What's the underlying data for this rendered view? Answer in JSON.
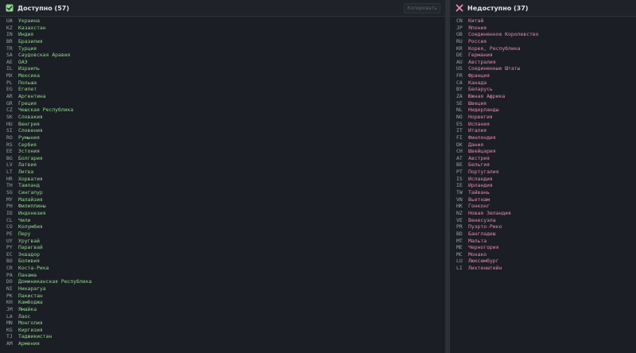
{
  "available": {
    "title": "Доступно (57)",
    "copy_label": "Копировать",
    "icon": "check-square-icon",
    "accent": "#8fd48b",
    "items": [
      {
        "code": "UA",
        "name": "Украина"
      },
      {
        "code": "KZ",
        "name": "Казахстан"
      },
      {
        "code": "IN",
        "name": "Индия"
      },
      {
        "code": "BR",
        "name": "Бразилия"
      },
      {
        "code": "TR",
        "name": "Турция"
      },
      {
        "code": "SA",
        "name": "Саудовская Аравия"
      },
      {
        "code": "AE",
        "name": "ОАЭ"
      },
      {
        "code": "IL",
        "name": "Израиль"
      },
      {
        "code": "MX",
        "name": "Мексика"
      },
      {
        "code": "PL",
        "name": "Польша"
      },
      {
        "code": "EG",
        "name": "Египет"
      },
      {
        "code": "AR",
        "name": "Аргентина"
      },
      {
        "code": "GR",
        "name": "Греция"
      },
      {
        "code": "CZ",
        "name": "Чешская Республика"
      },
      {
        "code": "SK",
        "name": "Словакия"
      },
      {
        "code": "HU",
        "name": "Венгрия"
      },
      {
        "code": "SI",
        "name": "Словения"
      },
      {
        "code": "RO",
        "name": "Румыния"
      },
      {
        "code": "RS",
        "name": "Сербия"
      },
      {
        "code": "EE",
        "name": "Эстония"
      },
      {
        "code": "BG",
        "name": "Болгария"
      },
      {
        "code": "LV",
        "name": "Латвия"
      },
      {
        "code": "LT",
        "name": "Литва"
      },
      {
        "code": "HR",
        "name": "Хорватия"
      },
      {
        "code": "TH",
        "name": "Таиланд"
      },
      {
        "code": "SG",
        "name": "Сингапур"
      },
      {
        "code": "MY",
        "name": "Малайзия"
      },
      {
        "code": "PH",
        "name": "Филиппины"
      },
      {
        "code": "ID",
        "name": "Индонезия"
      },
      {
        "code": "CL",
        "name": "Чили"
      },
      {
        "code": "CO",
        "name": "Колумбия"
      },
      {
        "code": "PE",
        "name": "Перу"
      },
      {
        "code": "UY",
        "name": "Уругвай"
      },
      {
        "code": "PY",
        "name": "Парагвай"
      },
      {
        "code": "EC",
        "name": "Эквадор"
      },
      {
        "code": "BO",
        "name": "Боливия"
      },
      {
        "code": "CR",
        "name": "Коста-Рика"
      },
      {
        "code": "PA",
        "name": "Панама"
      },
      {
        "code": "DO",
        "name": "Доминиканская Республика"
      },
      {
        "code": "NI",
        "name": "Никарагуа"
      },
      {
        "code": "PK",
        "name": "Пакистан"
      },
      {
        "code": "KH",
        "name": "Камбоджа"
      },
      {
        "code": "JM",
        "name": "Ямайка"
      },
      {
        "code": "LA",
        "name": "Лаос"
      },
      {
        "code": "MN",
        "name": "Монголия"
      },
      {
        "code": "KG",
        "name": "Киргизия"
      },
      {
        "code": "TJ",
        "name": "Таджикистан"
      },
      {
        "code": "AM",
        "name": "Армения"
      }
    ]
  },
  "unavailable": {
    "title": "Недоступно (37)",
    "icon": "x-mark-icon",
    "accent": "#e38ab3",
    "items": [
      {
        "code": "CN",
        "name": "Китай"
      },
      {
        "code": "JP",
        "name": "Япония"
      },
      {
        "code": "GB",
        "name": "Соединенное Королевство"
      },
      {
        "code": "RU",
        "name": "Россия"
      },
      {
        "code": "KR",
        "name": "Корея, Республика"
      },
      {
        "code": "DE",
        "name": "Германия"
      },
      {
        "code": "AU",
        "name": "Австралия"
      },
      {
        "code": "US",
        "name": "Соединенные Штаты"
      },
      {
        "code": "FR",
        "name": "Франция"
      },
      {
        "code": "CA",
        "name": "Канада"
      },
      {
        "code": "BY",
        "name": "Беларусь"
      },
      {
        "code": "ZA",
        "name": "Южная Африка"
      },
      {
        "code": "SE",
        "name": "Швеция"
      },
      {
        "code": "NL",
        "name": "Нидерланды"
      },
      {
        "code": "NO",
        "name": "Норвегия"
      },
      {
        "code": "ES",
        "name": "Испания"
      },
      {
        "code": "IT",
        "name": "Италия"
      },
      {
        "code": "FI",
        "name": "Финляндия"
      },
      {
        "code": "DK",
        "name": "Дания"
      },
      {
        "code": "CH",
        "name": "Швейцария"
      },
      {
        "code": "AT",
        "name": "Австрия"
      },
      {
        "code": "BE",
        "name": "Бельгия"
      },
      {
        "code": "PT",
        "name": "Португалия"
      },
      {
        "code": "IS",
        "name": "Исландия"
      },
      {
        "code": "IE",
        "name": "Ирландия"
      },
      {
        "code": "TW",
        "name": "Тайвань"
      },
      {
        "code": "VN",
        "name": "Вьетнам"
      },
      {
        "code": "HK",
        "name": "Гонконг"
      },
      {
        "code": "NZ",
        "name": "Новая Зеландия"
      },
      {
        "code": "VE",
        "name": "Венесуэла"
      },
      {
        "code": "PR",
        "name": "Пуэрто-Рико"
      },
      {
        "code": "BD",
        "name": "Бангладеш"
      },
      {
        "code": "MT",
        "name": "Мальта"
      },
      {
        "code": "ME",
        "name": "Черногория"
      },
      {
        "code": "MC",
        "name": "Монако"
      },
      {
        "code": "LU",
        "name": "Люксембург"
      },
      {
        "code": "LI",
        "name": "Лихтенштейн"
      }
    ]
  }
}
